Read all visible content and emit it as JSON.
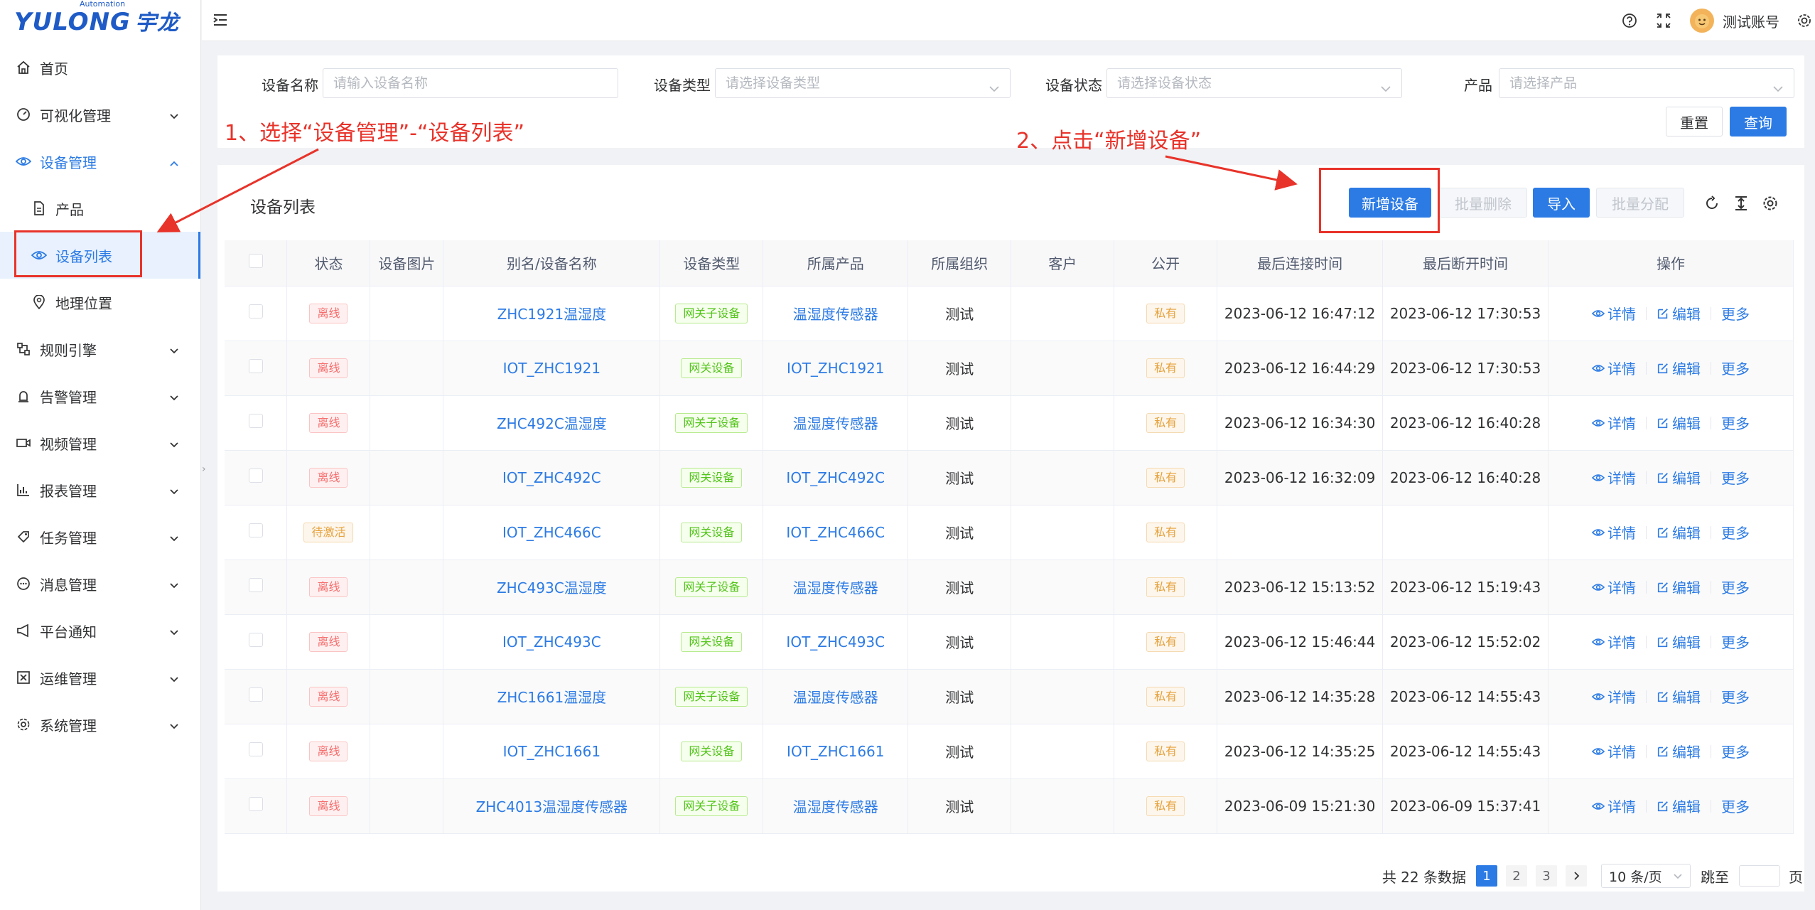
{
  "logo": {
    "brand": "YULONG",
    "sub": "Automation",
    "cn": "宇龙"
  },
  "sidebar": {
    "items": [
      {
        "label": "首页",
        "icon": "home-icon"
      },
      {
        "label": "可视化管理",
        "icon": "dashboard-icon"
      },
      {
        "label": "设备管理",
        "icon": "eye-icon"
      },
      {
        "label": "规则引擎",
        "icon": "rule-icon"
      },
      {
        "label": "告警管理",
        "icon": "alarm-icon"
      },
      {
        "label": "视频管理",
        "icon": "video-icon"
      },
      {
        "label": "报表管理",
        "icon": "chart-icon"
      },
      {
        "label": "任务管理",
        "icon": "task-icon"
      },
      {
        "label": "消息管理",
        "icon": "message-icon"
      },
      {
        "label": "平台通知",
        "icon": "megaphone-icon"
      },
      {
        "label": "运维管理",
        "icon": "ops-icon"
      },
      {
        "label": "系统管理",
        "icon": "gear-icon"
      }
    ],
    "sub": [
      {
        "label": "产品"
      },
      {
        "label": "设备列表"
      },
      {
        "label": "地理位置"
      }
    ]
  },
  "header": {
    "username": "测试账号"
  },
  "filter": {
    "name_label": "设备名称",
    "name_placeholder": "请输入设备名称",
    "type_label": "设备类型",
    "type_placeholder": "请选择设备类型",
    "status_label": "设备状态",
    "status_placeholder": "请选择设备状态",
    "product_label": "产品",
    "product_placeholder": "请选择产品",
    "reset": "重置",
    "search": "查询"
  },
  "annotations": {
    "step1": "1、选择“设备管理”-“设备列表”",
    "step2": "2、点击“新增设备”"
  },
  "list": {
    "title": "设备列表",
    "add": "新增设备",
    "batch_delete": "批量删除",
    "import": "导入",
    "batch_assign": "批量分配",
    "columns": [
      "状态",
      "设备图片",
      "别名/设备名称",
      "设备类型",
      "所属产品",
      "所属组织",
      "客户",
      "公开",
      "最后连接时间",
      "最后断开时间",
      "操作"
    ],
    "op_detail": "详情",
    "op_edit": "编辑",
    "op_more": "更多",
    "rows": [
      {
        "status": "离线",
        "name": "ZHC1921温湿度",
        "type": "网关子设备",
        "product": "温湿度传感器",
        "org": "测试",
        "public": "私有",
        "conn": "2023-06-12 16:47:12",
        "disc": "2023-06-12 17:30:53"
      },
      {
        "status": "离线",
        "name": "IOT_ZHC1921",
        "type": "网关设备",
        "product": "IOT_ZHC1921",
        "org": "测试",
        "public": "私有",
        "conn": "2023-06-12 16:44:29",
        "disc": "2023-06-12 17:30:53"
      },
      {
        "status": "离线",
        "name": "ZHC492C温湿度",
        "type": "网关子设备",
        "product": "温湿度传感器",
        "org": "测试",
        "public": "私有",
        "conn": "2023-06-12 16:34:30",
        "disc": "2023-06-12 16:40:28"
      },
      {
        "status": "离线",
        "name": "IOT_ZHC492C",
        "type": "网关设备",
        "product": "IOT_ZHC492C",
        "org": "测试",
        "public": "私有",
        "conn": "2023-06-12 16:32:09",
        "disc": "2023-06-12 16:40:28"
      },
      {
        "status": "待激活",
        "name": "IOT_ZHC466C",
        "type": "网关设备",
        "product": "IOT_ZHC466C",
        "org": "测试",
        "public": "私有",
        "conn": "",
        "disc": ""
      },
      {
        "status": "离线",
        "name": "ZHC493C温湿度",
        "type": "网关子设备",
        "product": "温湿度传感器",
        "org": "测试",
        "public": "私有",
        "conn": "2023-06-12 15:13:52",
        "disc": "2023-06-12 15:19:43"
      },
      {
        "status": "离线",
        "name": "IOT_ZHC493C",
        "type": "网关设备",
        "product": "IOT_ZHC493C",
        "org": "测试",
        "public": "私有",
        "conn": "2023-06-12 15:46:44",
        "disc": "2023-06-12 15:52:02"
      },
      {
        "status": "离线",
        "name": "ZHC1661温湿度",
        "type": "网关子设备",
        "product": "温湿度传感器",
        "org": "测试",
        "public": "私有",
        "conn": "2023-06-12 14:35:28",
        "disc": "2023-06-12 14:55:43"
      },
      {
        "status": "离线",
        "name": "IOT_ZHC1661",
        "type": "网关设备",
        "product": "IOT_ZHC1661",
        "org": "测试",
        "public": "私有",
        "conn": "2023-06-12 14:35:25",
        "disc": "2023-06-12 14:55:43"
      },
      {
        "status": "离线",
        "name": "ZHC4013温湿度传感器",
        "type": "网关子设备",
        "product": "温湿度传感器",
        "org": "测试",
        "public": "私有",
        "conn": "2023-06-09 15:21:30",
        "disc": "2023-06-09 15:37:41"
      }
    ]
  },
  "pagination": {
    "total_text": "共 22 条数据",
    "pages": [
      "1",
      "2",
      "3"
    ],
    "page_size": "10 条/页",
    "goto_label": "跳至",
    "page_unit": "页"
  },
  "colors": {
    "primary": "#2c7be5",
    "annotation": "#e8332a"
  }
}
